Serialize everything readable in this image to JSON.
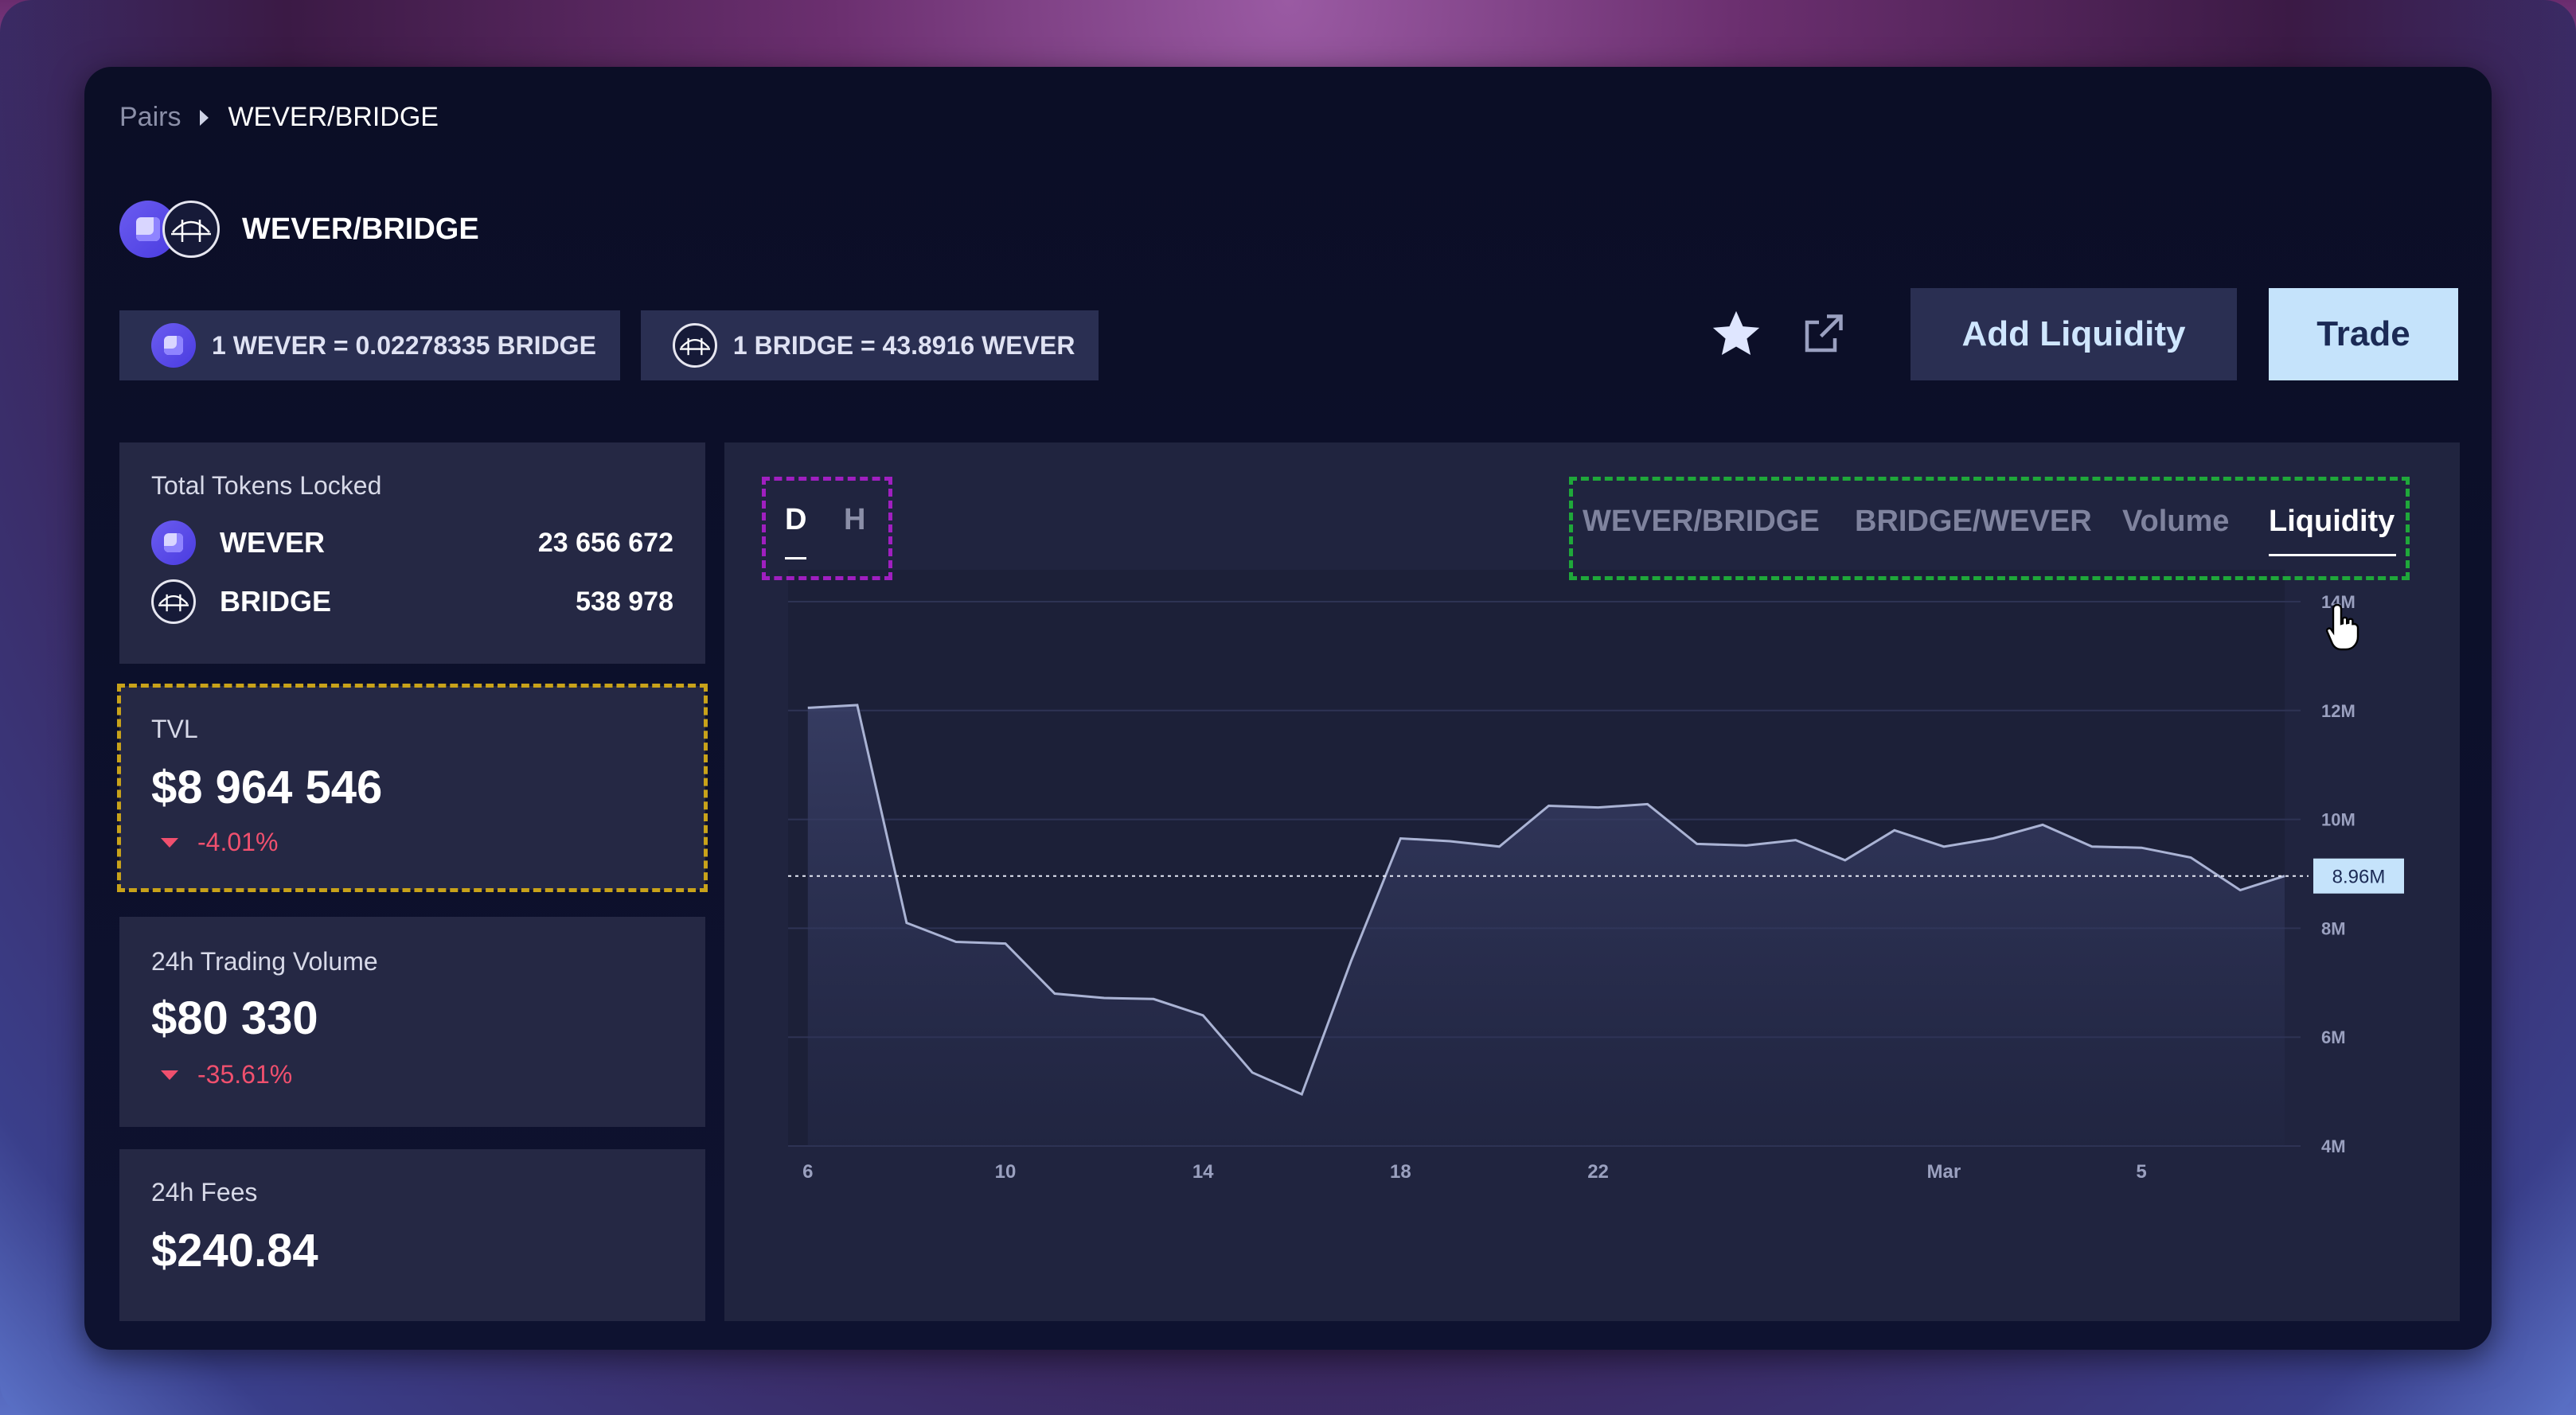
{
  "breadcrumb": {
    "root": "Pairs",
    "current": "WEVER/BRIDGE"
  },
  "pair": {
    "name": "WEVER/BRIDGE",
    "token_a": "WEVER",
    "token_b": "BRIDGE"
  },
  "rates": {
    "a_to_b": "1 WEVER = 0.02278335 BRIDGE",
    "b_to_a": "1 BRIDGE = 43.8916 WEVER"
  },
  "actions": {
    "add_liquidity": "Add Liquidity",
    "trade": "Trade",
    "star_icon": "star-icon",
    "external_icon": "external-link-icon"
  },
  "colors": {
    "accent": "#c5e3fb",
    "negative": "#f0506e",
    "line": "#aab3d4",
    "panel": "#252844"
  },
  "stats": {
    "locked": {
      "label": "Total Tokens Locked",
      "tokens": [
        {
          "symbol": "WEVER",
          "amount": "23 656 672"
        },
        {
          "symbol": "BRIDGE",
          "amount": "538 978"
        }
      ]
    },
    "tvl": {
      "label": "TVL",
      "value": "$8 964 546",
      "change": "-4.01%"
    },
    "volume": {
      "label": "24h Trading Volume",
      "value": "$80 330",
      "change": "-35.61%"
    },
    "fees": {
      "label": "24h Fees",
      "value": "$240.84"
    }
  },
  "chart_controls": {
    "periods": [
      "D",
      "H"
    ],
    "active_period": "D",
    "tabs": [
      "WEVER/BRIDGE",
      "BRIDGE/WEVER",
      "Volume",
      "Liquidity"
    ],
    "active_tab": "Liquidity"
  },
  "chart_data": {
    "type": "area",
    "y_unit_labels": [
      "4M",
      "6M",
      "8M",
      "10M",
      "12M",
      "14M"
    ],
    "y_ticks": [
      4,
      6,
      8,
      10,
      12,
      14
    ],
    "ylim": [
      4,
      14
    ],
    "x_tick_labels": [
      {
        "x": 6,
        "label": "6"
      },
      {
        "x": 10,
        "label": "10"
      },
      {
        "x": 14,
        "label": "14"
      },
      {
        "x": 18,
        "label": "18"
      },
      {
        "x": 22,
        "label": "22"
      },
      {
        "x": 29,
        "label": "Mar"
      },
      {
        "x": 33,
        "label": "5"
      }
    ],
    "xlim": [
      5.6,
      35.9
    ],
    "x": [
      6,
      7,
      8,
      9,
      10,
      11,
      12,
      13,
      14,
      15,
      16,
      17,
      18,
      19,
      20,
      21,
      22,
      23,
      24,
      25,
      26,
      27,
      28,
      29,
      30,
      31,
      32,
      33,
      34,
      35,
      35.9
    ],
    "values": [
      12.05,
      12.1,
      8.1,
      7.75,
      7.72,
      6.8,
      6.72,
      6.7,
      6.4,
      5.35,
      4.95,
      7.4,
      9.65,
      9.6,
      9.5,
      10.25,
      10.22,
      10.28,
      9.55,
      9.52,
      9.62,
      9.25,
      9.8,
      9.5,
      9.65,
      9.9,
      9.5,
      9.48,
      9.3,
      8.7,
      8.96
    ],
    "current_label": "8.96M",
    "current_value": 8.96
  }
}
